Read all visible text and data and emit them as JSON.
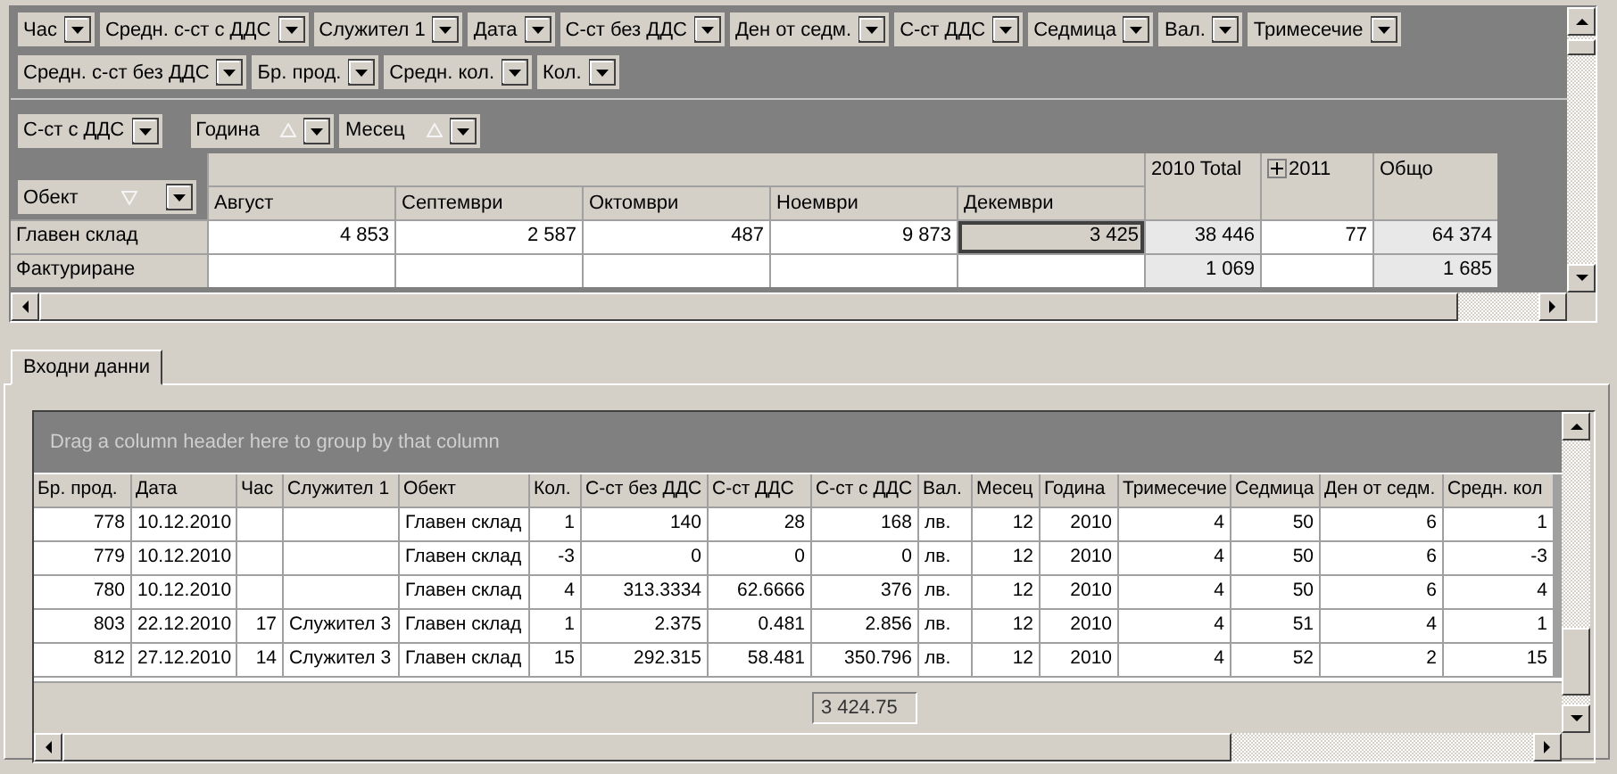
{
  "pivot": {
    "filter_rows": [
      [
        {
          "label": "Час"
        },
        {
          "label": "Средн. с-ст с ДДС"
        },
        {
          "label": "Служител 1"
        },
        {
          "label": "Дата"
        },
        {
          "label": "С-ст без ДДС"
        },
        {
          "label": "Ден от седм."
        },
        {
          "label": "С-ст ДДС"
        },
        {
          "label": "Седмица"
        },
        {
          "label": "Вал."
        },
        {
          "label": "Тримесечие"
        }
      ],
      [
        {
          "label": "Средн. с-ст без ДДС"
        },
        {
          "label": "Бр. прод."
        },
        {
          "label": "Средн. кол."
        },
        {
          "label": "Кол."
        }
      ]
    ],
    "data_field": {
      "label": "С-ст с ДДС"
    },
    "column_fields": [
      {
        "label": "Година",
        "descending": false
      },
      {
        "label": "Месец",
        "descending": false
      }
    ],
    "row_field": {
      "label": "Обект",
      "descending": true
    },
    "columns": [
      {
        "label": "Август",
        "kind": "month"
      },
      {
        "label": "Септември",
        "kind": "month"
      },
      {
        "label": "Октомври",
        "kind": "month"
      },
      {
        "label": "Ноември",
        "kind": "month"
      },
      {
        "label": "Декември",
        "kind": "month"
      },
      {
        "label": "2010 Total",
        "kind": "total"
      },
      {
        "label": "2011",
        "kind": "year",
        "expanded": false
      },
      {
        "label": "Общо",
        "kind": "total"
      }
    ],
    "rows": [
      {
        "label": "Главен склад",
        "cells": [
          {
            "value": "4 853",
            "selected": false
          },
          {
            "value": "2 587",
            "selected": false
          },
          {
            "value": "487",
            "selected": false
          },
          {
            "value": "9 873",
            "selected": false
          },
          {
            "value": "3 425",
            "selected": true
          },
          {
            "value": "38 446",
            "selected": false
          },
          {
            "value": "77",
            "selected": false
          },
          {
            "value": "64 374",
            "selected": false
          }
        ]
      },
      {
        "label": "Фактуриране",
        "cells": [
          {
            "selected": false
          },
          {
            "selected": false
          },
          {
            "selected": false
          },
          {
            "selected": false
          },
          {
            "selected": false
          },
          {
            "value": "1 069",
            "selected": false
          },
          {
            "selected": false
          },
          {
            "value": "1 685",
            "selected": false
          }
        ]
      }
    ]
  },
  "tabs": [
    {
      "label": "Входни данни",
      "selected": true
    }
  ],
  "grid": {
    "group_hint": "Drag a column header here to group by that column",
    "columns": [
      {
        "label": "Бр. прод.",
        "kind": "number"
      },
      {
        "label": "Дата",
        "kind": "text"
      },
      {
        "label": "Час",
        "kind": "number"
      },
      {
        "label": "Служител 1",
        "kind": "text"
      },
      {
        "label": "Обект",
        "kind": "text"
      },
      {
        "label": "Кол.",
        "kind": "number"
      },
      {
        "label": "С-ст без ДДС",
        "kind": "number"
      },
      {
        "label": "С-ст ДДС",
        "kind": "number"
      },
      {
        "label": "С-ст с ДДС",
        "kind": "number",
        "summary": "3 424.75"
      },
      {
        "label": "Вал.",
        "kind": "text"
      },
      {
        "label": "Месец",
        "kind": "number"
      },
      {
        "label": "Година",
        "kind": "number"
      },
      {
        "label": "Тримесечие",
        "kind": "number"
      },
      {
        "label": "Седмица",
        "kind": "number"
      },
      {
        "label": "Ден от седм.",
        "kind": "number"
      },
      {
        "label": "Средн. кол",
        "kind": "number"
      }
    ],
    "rows": [
      [
        {
          "value": "778"
        },
        {
          "value": "10.12.2010"
        },
        {},
        {},
        {
          "value": "Главен склад"
        },
        {
          "value": "1"
        },
        {
          "value": "140"
        },
        {
          "value": "28"
        },
        {
          "value": "168"
        },
        {
          "value": "лв."
        },
        {
          "value": "12"
        },
        {
          "value": "2010"
        },
        {
          "value": "4"
        },
        {
          "value": "50"
        },
        {
          "value": "6"
        },
        {
          "value": "1"
        }
      ],
      [
        {
          "value": "779"
        },
        {
          "value": "10.12.2010"
        },
        {},
        {},
        {
          "value": "Главен склад"
        },
        {
          "value": "-3"
        },
        {
          "value": "0"
        },
        {
          "value": "0"
        },
        {
          "value": "0"
        },
        {
          "value": "лв."
        },
        {
          "value": "12"
        },
        {
          "value": "2010"
        },
        {
          "value": "4"
        },
        {
          "value": "50"
        },
        {
          "value": "6"
        },
        {
          "value": "-3"
        }
      ],
      [
        {
          "value": "780"
        },
        {
          "value": "10.12.2010"
        },
        {},
        {},
        {
          "value": "Главен склад"
        },
        {
          "value": "4"
        },
        {
          "value": "313.3334"
        },
        {
          "value": "62.6666"
        },
        {
          "value": "376"
        },
        {
          "value": "лв."
        },
        {
          "value": "12"
        },
        {
          "value": "2010"
        },
        {
          "value": "4"
        },
        {
          "value": "50"
        },
        {
          "value": "6"
        },
        {
          "value": "4"
        }
      ],
      [
        {
          "value": "803"
        },
        {
          "value": "22.12.2010"
        },
        {
          "value": "17"
        },
        {
          "value": "Служител 3"
        },
        {
          "value": "Главен склад"
        },
        {
          "value": "1"
        },
        {
          "value": "2.375"
        },
        {
          "value": "0.481"
        },
        {
          "value": "2.856"
        },
        {
          "value": "лв."
        },
        {
          "value": "12"
        },
        {
          "value": "2010"
        },
        {
          "value": "4"
        },
        {
          "value": "51"
        },
        {
          "value": "4"
        },
        {
          "value": "1"
        }
      ],
      [
        {
          "value": "812"
        },
        {
          "value": "27.12.2010"
        },
        {
          "value": "14"
        },
        {
          "value": "Служител 3"
        },
        {
          "value": "Главен склад"
        },
        {
          "value": "15"
        },
        {
          "value": "292.315"
        },
        {
          "value": "58.481"
        },
        {
          "value": "350.796"
        },
        {
          "value": "лв."
        },
        {
          "value": "12"
        },
        {
          "value": "2010"
        },
        {
          "value": "4"
        },
        {
          "value": "52"
        },
        {
          "value": "2"
        },
        {
          "value": "15"
        }
      ]
    ]
  }
}
